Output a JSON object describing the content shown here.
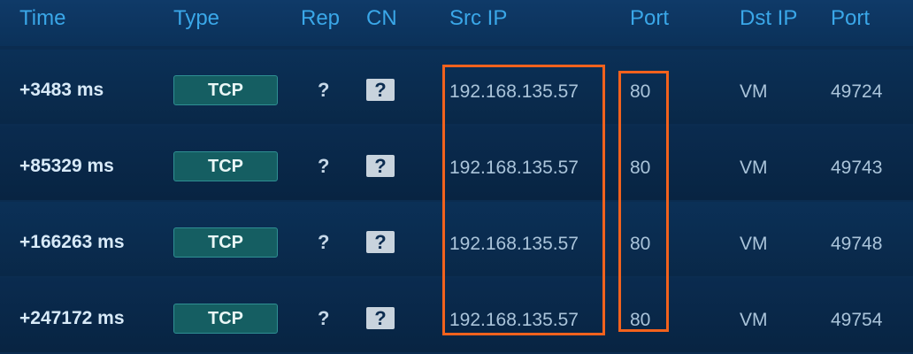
{
  "columns": {
    "time": "Time",
    "type": "Type",
    "rep": "Rep",
    "cn": "CN",
    "src_ip": "Src IP",
    "src_port": "Port",
    "dst_ip": "Dst IP",
    "dst_port": "Port"
  },
  "rows": [
    {
      "time": "+3483 ms",
      "type": "TCP",
      "rep": "?",
      "cn": "?",
      "src_ip": "192.168.135.57",
      "src_port": "80",
      "dst_ip": "VM",
      "dst_port": "49724"
    },
    {
      "time": "+85329 ms",
      "type": "TCP",
      "rep": "?",
      "cn": "?",
      "src_ip": "192.168.135.57",
      "src_port": "80",
      "dst_ip": "VM",
      "dst_port": "49743"
    },
    {
      "time": "+166263 ms",
      "type": "TCP",
      "rep": "?",
      "cn": "?",
      "src_ip": "192.168.135.57",
      "src_port": "80",
      "dst_ip": "VM",
      "dst_port": "49748"
    },
    {
      "time": "+247172 ms",
      "type": "TCP",
      "rep": "?",
      "cn": "?",
      "src_ip": "192.168.135.57",
      "src_port": "80",
      "dst_ip": "VM",
      "dst_port": "49754"
    }
  ],
  "colors": {
    "background": "#0b2c50",
    "header_text": "#3aa7e8",
    "badge": "#155e62",
    "highlight": "#f2621d"
  }
}
